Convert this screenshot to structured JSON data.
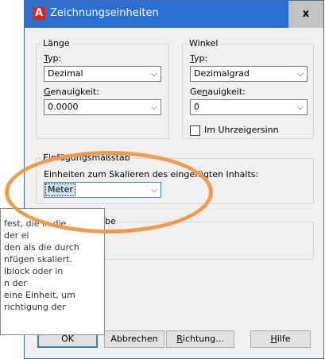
{
  "window": {
    "title": "Zeichnungseinheiten",
    "close_label": "x",
    "app_icon_letter": "A",
    "app_icon_color": "#e41f1f",
    "titlebar_color": "#2a6fd0"
  },
  "length": {
    "group_title": "Länge",
    "type_label": "Typ:",
    "type_value": "Dezimal",
    "precision_label": "Genauigkeit:",
    "precision_value": "0.0000"
  },
  "angle": {
    "group_title": "Winkel",
    "type_label": "Typ:",
    "type_value": "Dezimalgrad",
    "precision_label": "Genauigkeit:",
    "precision_value": "0",
    "clockwise_label": "Im Uhrzeigersinn",
    "clockwise_checked": false
  },
  "insertion": {
    "group_title": "Einfügungsmaßstab",
    "description": "Einheiten zum Skalieren des eingefügten Inhalts:",
    "units_value": "Meter"
  },
  "output": {
    "group_title_partial": "be"
  },
  "tooltip": {
    "lines": [
      "fest, die in die",
      "der ei",
      "den als die durch",
      "nfügen skaliert.",
      "lblock oder in",
      "n der",
      "eine Einheit, um",
      "richtigung der"
    ]
  },
  "buttons": {
    "ok": "OK",
    "cancel": "Abbrechen",
    "direction": "Richtung...",
    "help": "Hilfe"
  },
  "annotation_color": "#f39b4a"
}
